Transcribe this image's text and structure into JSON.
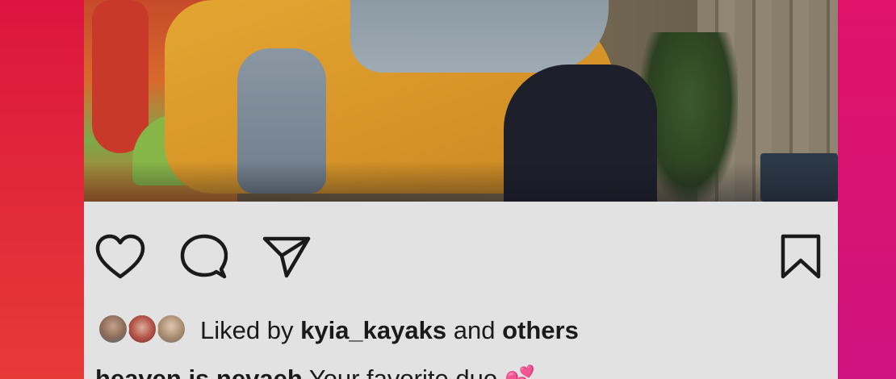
{
  "post": {
    "photo_alt": "",
    "actions": {
      "like_icon": "heart-icon",
      "comment_icon": "comment-bubble-icon",
      "share_icon": "paper-plane-icon",
      "save_icon": "bookmark-icon"
    },
    "likes": {
      "prefix": "Liked by",
      "user": "kyia_kayaks",
      "joiner": "and",
      "others": "others"
    },
    "caption": {
      "username": "heaven.is.nevaeh",
      "text": "Your favorite duo",
      "emoji": "💕"
    }
  },
  "colors": {
    "background_left": "#e0253a",
    "background_right": "#d81373",
    "card": "#e2e2e2",
    "text": "#1a1a1a"
  }
}
